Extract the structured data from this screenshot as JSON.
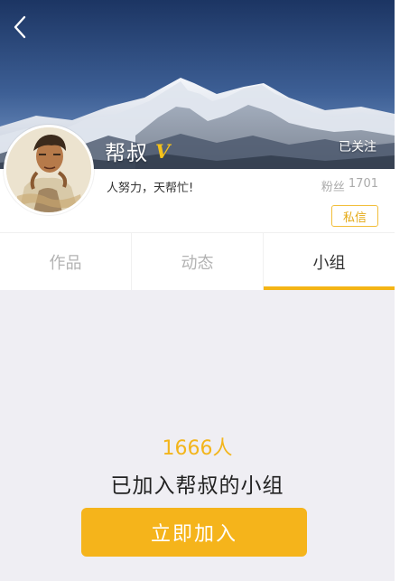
{
  "profile": {
    "name": "帮叔",
    "verified_mark": "V",
    "follow_status": "已关注",
    "bio": "人努力，天帮忙!",
    "fans_label": "粉丝",
    "fans_count": "1701",
    "message_button": "私信"
  },
  "tabs": [
    {
      "label": "作品",
      "active": false
    },
    {
      "label": "动态",
      "active": false
    },
    {
      "label": "小组",
      "active": true
    }
  ],
  "group": {
    "member_count": "1666人",
    "caption": "已加入帮叔的小组",
    "join_button": "立即加入"
  },
  "colors": {
    "accent": "#f5b41b",
    "page_background": "#efeef3",
    "sky_top": "#1f3a66",
    "sky_bottom": "#6b8fc2"
  },
  "icons": {
    "back": "chevron-left-icon",
    "verified": "verified-v-icon"
  }
}
